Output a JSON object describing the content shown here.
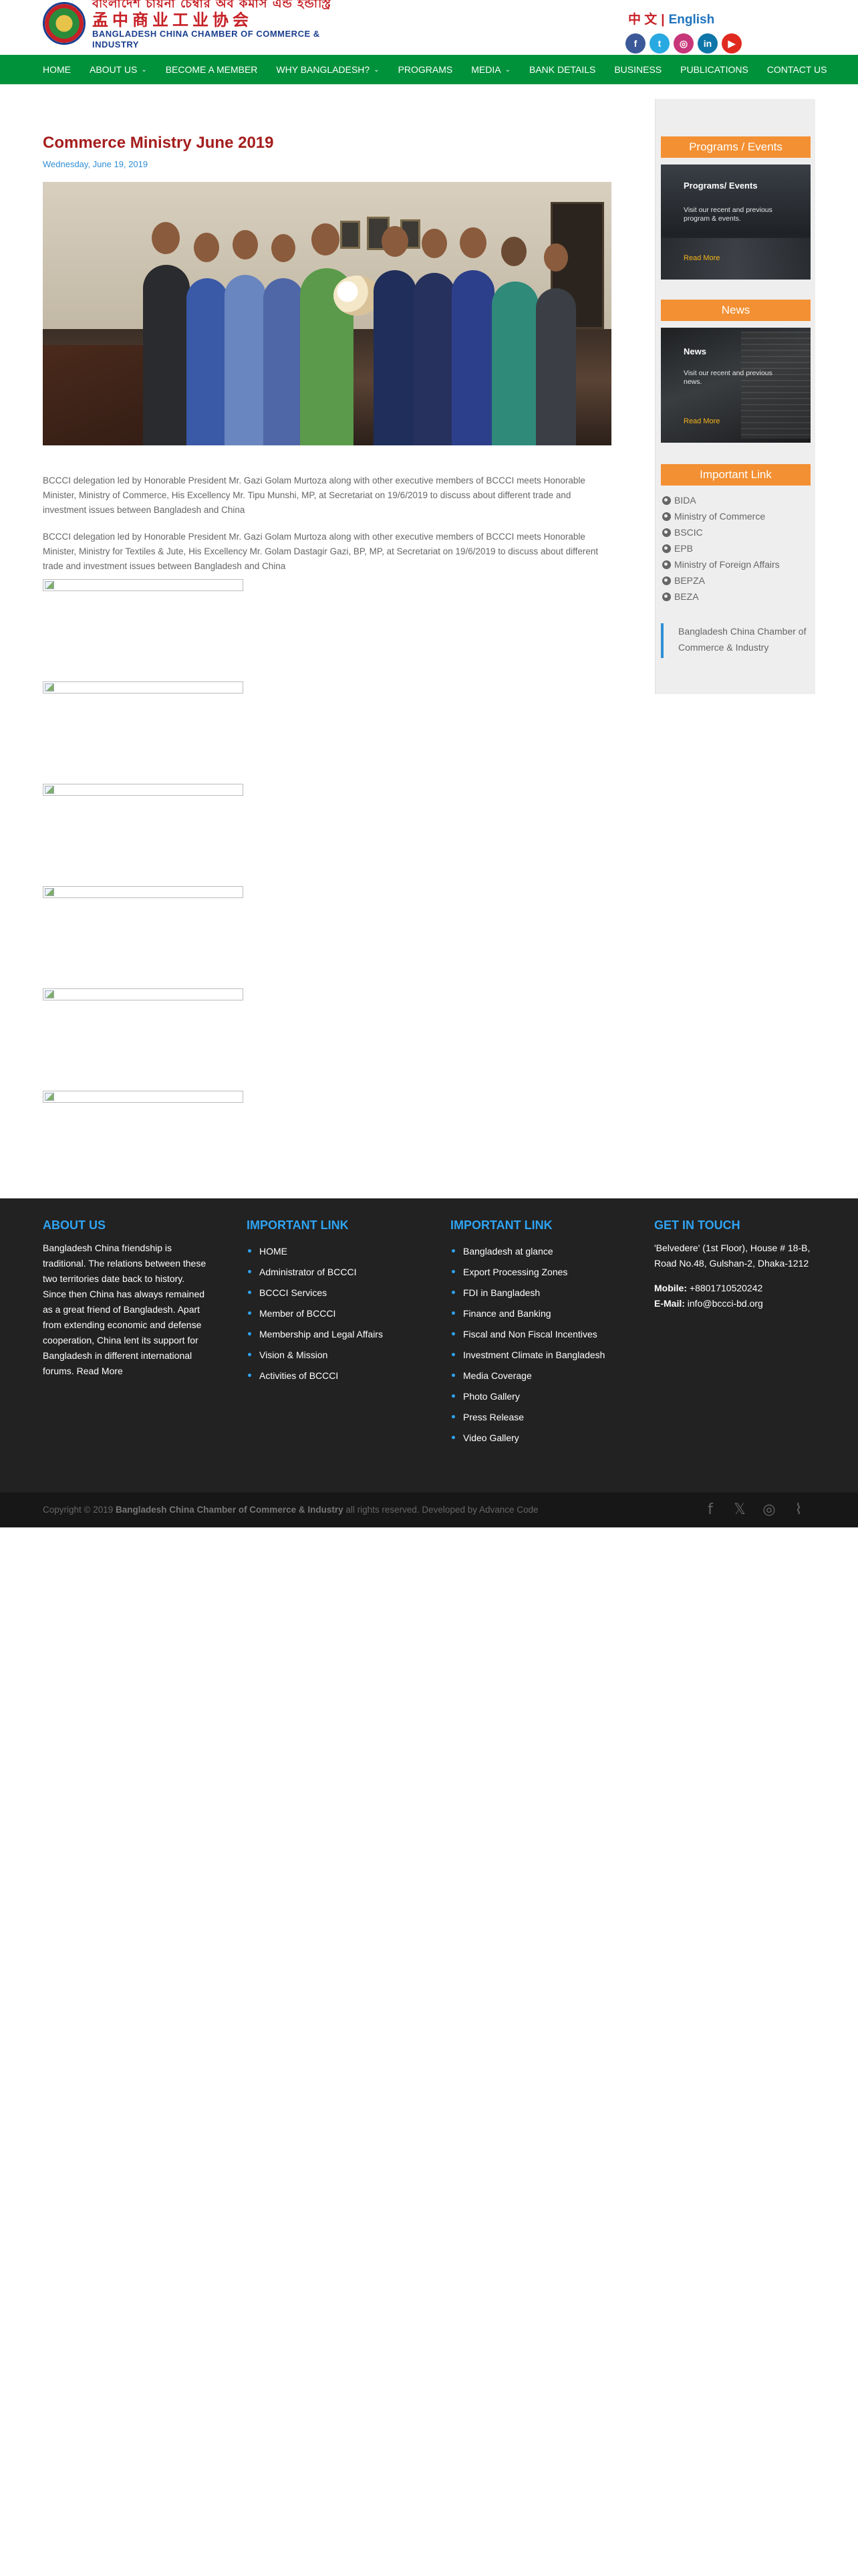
{
  "header": {
    "logo": {
      "bn_text": "বাংলাদেশ চায়না চেম্বার অব কমার্স এন্ড ইন্ডাস্ট্রি",
      "cn_text": "孟中商业工业协会",
      "en_text": "BANGLADESH CHINA CHAMBER OF COMMERCE & INDUSTRY"
    },
    "language": {
      "chinese": "中 文",
      "separator": "|",
      "english": "English"
    },
    "social": [
      {
        "icon": "facebook-icon",
        "glyph": "f",
        "color": "#3b5998"
      },
      {
        "icon": "twitter-icon",
        "glyph": "t",
        "color": "#29a9e1"
      },
      {
        "icon": "instagram-icon",
        "glyph": "◎",
        "color": "#c8367a"
      },
      {
        "icon": "linkedin-icon",
        "glyph": "in",
        "color": "#0e76a8"
      },
      {
        "icon": "youtube-icon",
        "glyph": "▶",
        "color": "#e02a20"
      }
    ]
  },
  "nav": {
    "items": [
      {
        "label": "HOME",
        "dropdown": false
      },
      {
        "label": "ABOUT US",
        "dropdown": true
      },
      {
        "label": "BECOME A MEMBER",
        "dropdown": false
      },
      {
        "label": "WHY BANGLADESH?",
        "dropdown": true
      },
      {
        "label": "PROGRAMS",
        "dropdown": false
      },
      {
        "label": "MEDIA",
        "dropdown": true
      },
      {
        "label": "BANK DETAILS",
        "dropdown": false
      },
      {
        "label": "BUSINESS",
        "dropdown": false
      },
      {
        "label": "PUBLICATIONS",
        "dropdown": false
      },
      {
        "label": "CONTACT US",
        "dropdown": false
      }
    ]
  },
  "post": {
    "title": "Commerce Ministry June 2019",
    "date": "Wednesday, June 19, 2019",
    "paragraph1": "BCCCI delegation led by Honorable President Mr. Gazi Golam Murtoza along with other executive members of BCCCI meets Honorable Minister, Ministry of Commerce, His Excellency Mr. Tipu Munshi, MP, at Secretariat on 19/6/2019 to discuss about different trade and investment issues between Bangladesh and China",
    "paragraph2": "BCCCI delegation led by Honorable President Mr. Gazi Golam Murtoza along with other executive members of BCCCI meets Honorable Minister, Ministry for Textiles & Jute, His Excellency Mr. Golam Dastagir Gazi, BP, MP, at Secretariat on 19/6/2019 to discuss about different trade and investment issues between Bangladesh and China"
  },
  "sidebar": {
    "programs": {
      "heading": "Programs / Events",
      "card_title": "Programs/ Events",
      "card_text": "Visit our recent and previous program & events.",
      "card_more": "Read More"
    },
    "news": {
      "heading": "News",
      "card_title": "News",
      "card_text": "Visit our recent and previous news.",
      "card_more": "Read More"
    },
    "important_link": {
      "heading": "Important Link",
      "items": [
        "BIDA",
        "Ministry of Commerce",
        "BSCIC",
        "EPB",
        "Ministry of Foreign Affairs",
        "BEPZA",
        "BEZA"
      ]
    },
    "quote": "Bangladesh China Chamber of Commerce & Industry"
  },
  "footer": {
    "about": {
      "heading": "ABOUT US",
      "text": "Bangladesh China friendship is traditional. The relations between these two territories date back to history. Since then China has always remained as a great friend of Bangladesh. Apart from extending economic and defense cooperation, China lent its support for Bangladesh in different international forums.",
      "read_more": "Read More"
    },
    "links1": {
      "heading": "IMPORTANT LINK",
      "items": [
        "HOME",
        "Administrator of BCCCI",
        "BCCCI Services",
        "Member of BCCCI",
        "Membership and Legal Affairs",
        "Vision & Mission",
        "Activities of BCCCI"
      ]
    },
    "links2": {
      "heading": "IMPORTANT LINK",
      "items": [
        "Bangladesh at glance",
        "Export Processing Zones",
        "FDI in Bangladesh",
        "Finance and Banking",
        "Fiscal and Non Fiscal Incentives",
        "Investment Climate in Bangladesh",
        "Media Coverage",
        "Photo Gallery",
        "Press Release",
        "Video Gallery"
      ]
    },
    "contact": {
      "heading": "GET IN TOUCH",
      "address": "'Belvedere' (1st Floor), House # 18-B, Road No.48, Gulshan-2, Dhaka-1212",
      "mobile_label": "Mobile:",
      "mobile": "+8801710520242",
      "email_label": "E-Mail:",
      "email": "info@bccci-bd.org"
    }
  },
  "bottom": {
    "copyright_prefix": "Copyright © 2019",
    "org": "Bangladesh China Chamber of Commerce & Industry",
    "copyright_suffix": "all rights reserved. Developed by Advance Code",
    "social": [
      {
        "icon": "facebook-icon",
        "glyph": "f"
      },
      {
        "icon": "x-twitter-icon",
        "glyph": "𝕏"
      },
      {
        "icon": "instagram-icon",
        "glyph": "◎"
      },
      {
        "icon": "rss-icon",
        "glyph": "⌇"
      }
    ]
  }
}
